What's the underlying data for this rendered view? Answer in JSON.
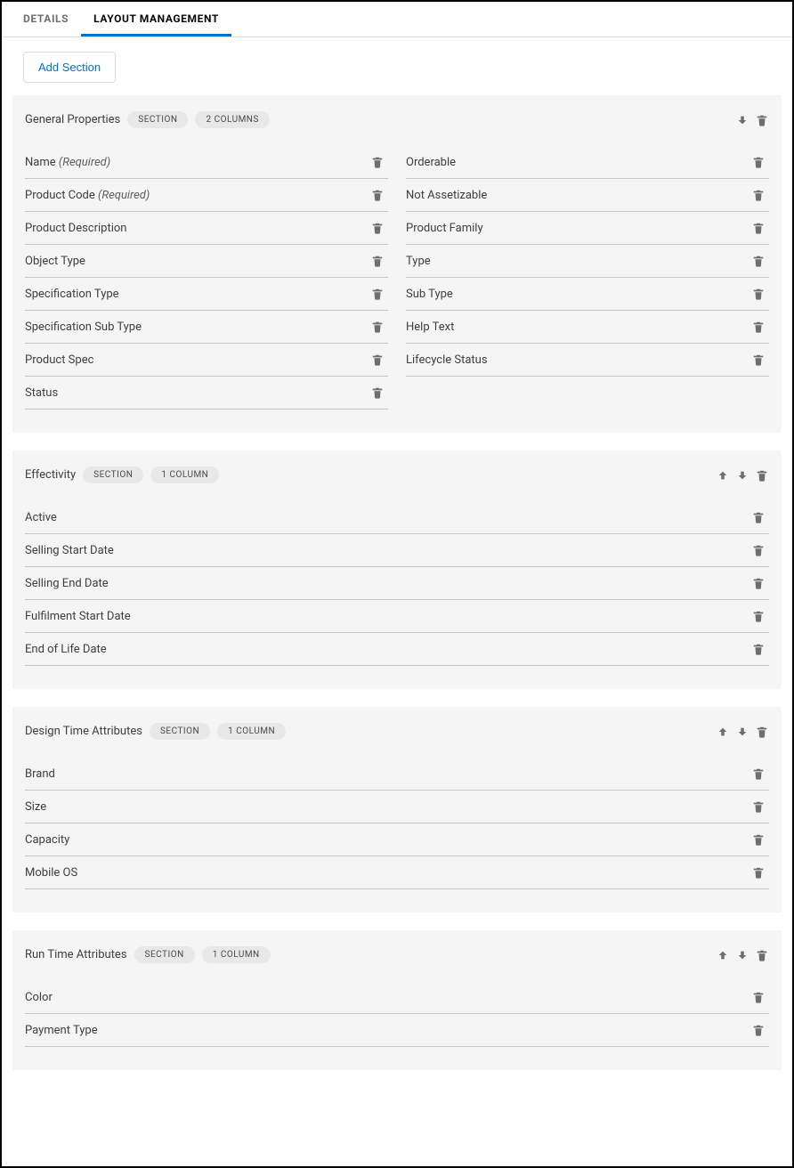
{
  "tabs": {
    "details": "DETAILS",
    "layout": "LAYOUT MANAGEMENT"
  },
  "buttons": {
    "add_section": "Add Section"
  },
  "labels": {
    "section_pill": "SECTION",
    "col1_pill": "1 COLUMN",
    "col2_pill": "2 COLUMNS",
    "required": "(Required)"
  },
  "sections": {
    "general": {
      "title": "General Properties",
      "left": [
        {
          "label": "Name",
          "required": true
        },
        {
          "label": "Product Code",
          "required": true
        },
        {
          "label": "Product Description"
        },
        {
          "label": "Object Type"
        },
        {
          "label": "Specification Type"
        },
        {
          "label": "Specification Sub Type"
        },
        {
          "label": "Product Spec"
        },
        {
          "label": "Status"
        }
      ],
      "right": [
        {
          "label": "Orderable"
        },
        {
          "label": "Not Assetizable"
        },
        {
          "label": "Product Family"
        },
        {
          "label": "Type"
        },
        {
          "label": "Sub Type"
        },
        {
          "label": "Help Text"
        },
        {
          "label": "Lifecycle Status"
        }
      ]
    },
    "effectivity": {
      "title": "Effectivity",
      "fields": [
        {
          "label": "Active"
        },
        {
          "label": "Selling Start Date"
        },
        {
          "label": "Selling End Date"
        },
        {
          "label": "Fulfilment Start Date"
        },
        {
          "label": "End of Life Date"
        }
      ]
    },
    "design": {
      "title": "Design Time Attributes",
      "fields": [
        {
          "label": "Brand"
        },
        {
          "label": "Size"
        },
        {
          "label": "Capacity"
        },
        {
          "label": "Mobile OS"
        }
      ]
    },
    "runtime": {
      "title": "Run Time Attributes",
      "fields": [
        {
          "label": "Color"
        },
        {
          "label": "Payment Type"
        }
      ]
    }
  }
}
